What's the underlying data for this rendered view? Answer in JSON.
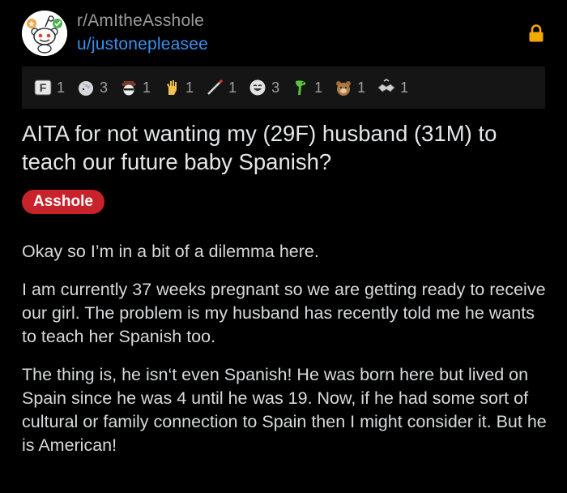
{
  "post": {
    "subreddit": "r/AmItheAsshole",
    "username": "u/justonepleasee",
    "title": "AITA for not wanting my (29F) husband (31M) to teach our future baby Spanish?",
    "flair": "Asshole",
    "body": [
      "Okay so I’m in a bit of a dilemma here.",
      "I am currently 37 weeks pregnant so we are getting ready to receive our girl. The problem is my husband has recently told me he wants to teach her Spanish too.",
      "The thing is, he isn‘t even Spanish! He was born here but lived on Spain since he was 4 until he was 19. Now, if he had some sort of cultural or family connection to Spain then I might consider it. But he is American!"
    ]
  },
  "awards": [
    {
      "icon": "f-award-icon",
      "count": "1"
    },
    {
      "icon": "facepalm-award-icon",
      "count": "3"
    },
    {
      "icon": "spy-award-icon",
      "count": "1"
    },
    {
      "icon": "hand-award-icon",
      "count": "1"
    },
    {
      "icon": "brush-award-icon",
      "count": "1"
    },
    {
      "icon": "laughing-award-icon",
      "count": "3"
    },
    {
      "icon": "dinosaur-award-icon",
      "count": "1"
    },
    {
      "icon": "bear-award-icon",
      "count": "1"
    },
    {
      "icon": "handshake-award-icon",
      "count": "1"
    }
  ],
  "colors": {
    "background": "#000000",
    "username_blue": "#3a8ff0",
    "flair_red": "#c8232b",
    "lock_gold": "#f2a900"
  }
}
